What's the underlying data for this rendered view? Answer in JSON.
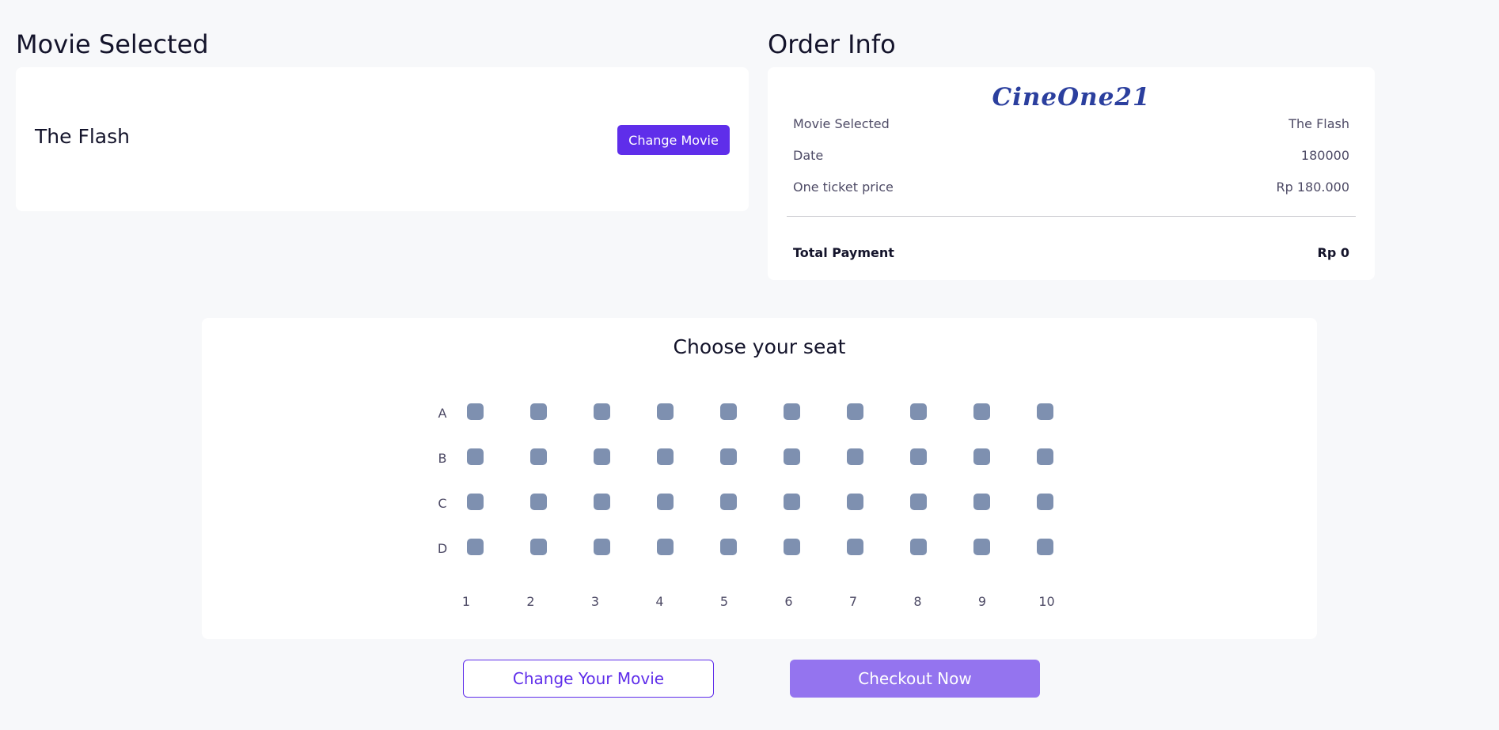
{
  "movie_section": {
    "title": "Movie Selected",
    "movie_name": "The Flash",
    "change_button": "Change Movie"
  },
  "order_section": {
    "title": "Order Info",
    "logo_text": "CineOne21",
    "rows": [
      {
        "label": "Movie Selected",
        "value": "The Flash"
      },
      {
        "label": "Date",
        "value": "180000"
      },
      {
        "label": "One ticket price",
        "value": "Rp 180.000"
      }
    ],
    "total_label": "Total Payment",
    "total_value": "Rp 0"
  },
  "seat_section": {
    "title": "Choose your seat",
    "rows": [
      "A",
      "B",
      "C",
      "D"
    ],
    "columns": [
      "1",
      "2",
      "3",
      "4",
      "5",
      "6",
      "7",
      "8",
      "9",
      "10"
    ],
    "seat_color": "#7E90B0"
  },
  "actions": {
    "change_movie": "Change Your Movie",
    "checkout": "Checkout Now"
  },
  "colors": {
    "primary": "#5F2EEA",
    "primary_light": "#9474EF",
    "logo": "#2B3F9E",
    "background": "#F7F8FA"
  }
}
